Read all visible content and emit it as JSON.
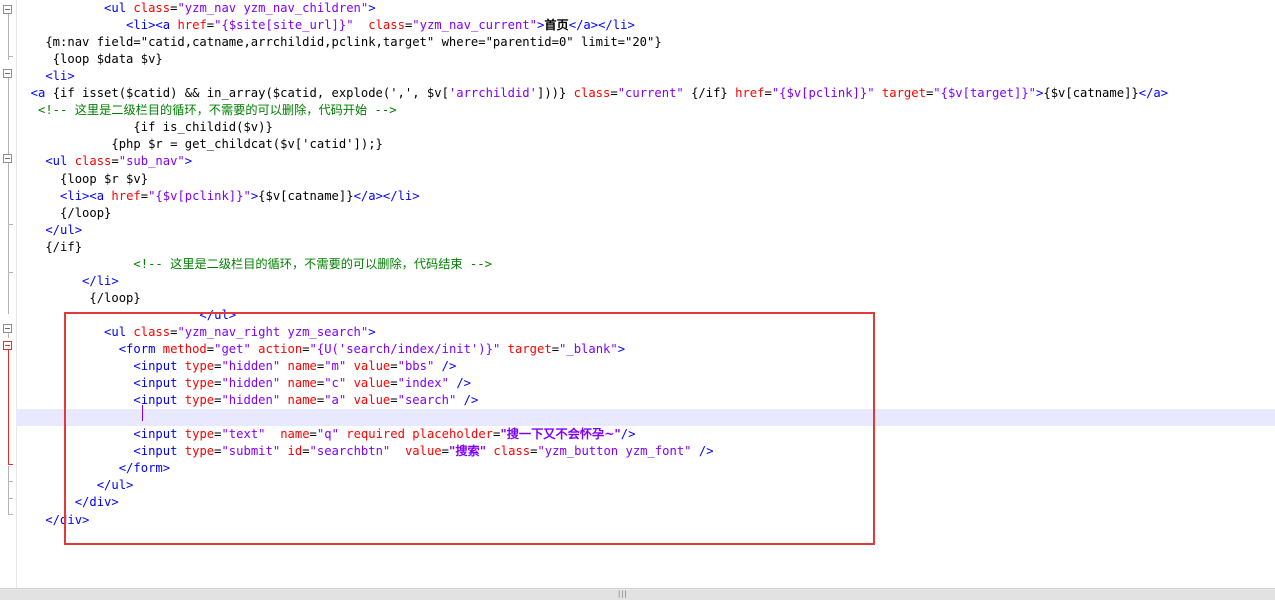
{
  "editor": {
    "lines": [
      [
        [
          "t",
          "            <ul "
        ],
        [
          "a",
          "class"
        ],
        [
          "x",
          "="
        ],
        [
          "v",
          "\"yzm_nav yzm_nav_children\""
        ],
        [
          "t",
          ">"
        ]
      ],
      [
        [
          "t",
          "               <li><a "
        ],
        [
          "a",
          "href"
        ],
        [
          "x",
          "="
        ],
        [
          "v",
          "\"{$site[site_url]}\""
        ],
        [
          "x",
          "  "
        ],
        [
          "a",
          "class"
        ],
        [
          "x",
          "="
        ],
        [
          "v",
          "\"yzm_nav_current\""
        ],
        [
          "t",
          ">"
        ],
        [
          "xb",
          "首页"
        ],
        [
          "t",
          "</a></li>"
        ]
      ],
      [
        [
          "x",
          "    {m:nav field=\"catid,catname,arrchildid,pclink,target\" where=\"parentid=0\" limit=\"20\"}"
        ]
      ],
      [
        [
          "x",
          "     {loop $data $v}"
        ]
      ],
      [
        [
          "t",
          "    <li>"
        ]
      ],
      [
        [
          "t",
          "  <a "
        ],
        [
          "x",
          "{if isset($catid) && in_array($catid, explode(',', $v["
        ],
        [
          "v",
          "'arrchildid'"
        ],
        [
          "x",
          "]))} "
        ],
        [
          "a",
          "class"
        ],
        [
          "x",
          "="
        ],
        [
          "v",
          "\"current\""
        ],
        [
          "x",
          " {/if} "
        ],
        [
          "a",
          "href"
        ],
        [
          "x",
          "="
        ],
        [
          "v",
          "\"{$v[pclink]}\""
        ],
        [
          "x",
          " "
        ],
        [
          "a",
          "target"
        ],
        [
          "x",
          "="
        ],
        [
          "v",
          "\"{$v[target]}\""
        ],
        [
          "t",
          ">"
        ],
        [
          "x",
          "{$v[catname]}"
        ],
        [
          "t",
          "</a>"
        ]
      ],
      [
        [
          "c",
          "   <!-- 这里是二级栏目的循环，不需要的可以删除，代码开始 -->"
        ]
      ],
      [
        [
          "x",
          "                {if is_childid($v)}"
        ]
      ],
      [
        [
          "x",
          "             {php $r = get_childcat($v['catid']);}"
        ]
      ],
      [
        [
          "t",
          "    <ul "
        ],
        [
          "a",
          "class"
        ],
        [
          "x",
          "="
        ],
        [
          "v",
          "\"sub_nav\""
        ],
        [
          "t",
          ">"
        ]
      ],
      [
        [
          "x",
          "      {loop $r $v}"
        ]
      ],
      [
        [
          "t",
          "      <li><a "
        ],
        [
          "a",
          "href"
        ],
        [
          "x",
          "="
        ],
        [
          "v",
          "\"{$v[pclink]}\""
        ],
        [
          "t",
          ">"
        ],
        [
          "x",
          "{$v[catname]}"
        ],
        [
          "t",
          "</a></li>"
        ]
      ],
      [
        [
          "x",
          "      {/loop}"
        ]
      ],
      [
        [
          "t",
          "    </ul>"
        ]
      ],
      [
        [
          "x",
          "    {/if}"
        ]
      ],
      [
        [
          "c",
          "                <!-- 这里是二级栏目的循环，不需要的可以删除，代码结束 -->"
        ]
      ],
      [
        [
          "t",
          "         </li>"
        ]
      ],
      [
        [
          "x",
          "          {/loop}"
        ]
      ],
      [
        [
          "t",
          "                         </ul>"
        ]
      ],
      [
        [
          "t",
          "            <ul "
        ],
        [
          "a",
          "class"
        ],
        [
          "x",
          "="
        ],
        [
          "v",
          "\"yzm_nav_right yzm_search\""
        ],
        [
          "t",
          ">"
        ]
      ],
      [
        [
          "t",
          "              <form "
        ],
        [
          "a",
          "method"
        ],
        [
          "x",
          "="
        ],
        [
          "v",
          "\"get\""
        ],
        [
          "x",
          " "
        ],
        [
          "a",
          "action"
        ],
        [
          "x",
          "="
        ],
        [
          "v",
          "\"{U('search/index/init')}\""
        ],
        [
          "x",
          " "
        ],
        [
          "a",
          "target"
        ],
        [
          "x",
          "="
        ],
        [
          "v",
          "\"_blank\""
        ],
        [
          "t",
          ">"
        ]
      ],
      [
        [
          "t",
          "                <input "
        ],
        [
          "a",
          "type"
        ],
        [
          "x",
          "="
        ],
        [
          "v",
          "\"hidden\""
        ],
        [
          "x",
          " "
        ],
        [
          "a",
          "name"
        ],
        [
          "x",
          "="
        ],
        [
          "v",
          "\"m\""
        ],
        [
          "x",
          " "
        ],
        [
          "a",
          "value"
        ],
        [
          "x",
          "="
        ],
        [
          "v",
          "\"bbs\""
        ],
        [
          "x",
          " "
        ],
        [
          "t",
          "/>"
        ]
      ],
      [
        [
          "t",
          "                <input "
        ],
        [
          "a",
          "type"
        ],
        [
          "x",
          "="
        ],
        [
          "v",
          "\"hidden\""
        ],
        [
          "x",
          " "
        ],
        [
          "a",
          "name"
        ],
        [
          "x",
          "="
        ],
        [
          "v",
          "\"c\""
        ],
        [
          "x",
          " "
        ],
        [
          "a",
          "value"
        ],
        [
          "x",
          "="
        ],
        [
          "v",
          "\"index\""
        ],
        [
          "x",
          " "
        ],
        [
          "t",
          "/>"
        ]
      ],
      [
        [
          "t",
          "                <input "
        ],
        [
          "a",
          "type"
        ],
        [
          "x",
          "="
        ],
        [
          "v",
          "\"hidden\""
        ],
        [
          "x",
          " "
        ],
        [
          "a",
          "name"
        ],
        [
          "x",
          "="
        ],
        [
          "v",
          "\"a\""
        ],
        [
          "x",
          " "
        ],
        [
          "a",
          "value"
        ],
        [
          "x",
          "="
        ],
        [
          "v",
          "\"search\""
        ],
        [
          "x",
          " "
        ],
        [
          "t",
          "/>"
        ]
      ],
      [
        [
          "x",
          ""
        ]
      ],
      [
        [
          "t",
          "                <input "
        ],
        [
          "a",
          "type"
        ],
        [
          "x",
          "="
        ],
        [
          "v",
          "\"text\""
        ],
        [
          "x",
          "  "
        ],
        [
          "a",
          "name"
        ],
        [
          "x",
          "="
        ],
        [
          "v",
          "\"q\""
        ],
        [
          "x",
          " "
        ],
        [
          "a",
          "required"
        ],
        [
          "x",
          " "
        ],
        [
          "a",
          "placeholder"
        ],
        [
          "x",
          "="
        ],
        [
          "b",
          "\"搜一下又不会怀孕~\""
        ],
        [
          "t",
          "/>"
        ]
      ],
      [
        [
          "t",
          "                <input "
        ],
        [
          "a",
          "type"
        ],
        [
          "x",
          "="
        ],
        [
          "v",
          "\"submit\""
        ],
        [
          "x",
          " "
        ],
        [
          "a",
          "id"
        ],
        [
          "x",
          "="
        ],
        [
          "v",
          "\"searchbtn\""
        ],
        [
          "x",
          "  "
        ],
        [
          "a",
          "value"
        ],
        [
          "x",
          "="
        ],
        [
          "b",
          "\"搜索\""
        ],
        [
          "x",
          " "
        ],
        [
          "a",
          "class"
        ],
        [
          "x",
          "="
        ],
        [
          "v",
          "\"yzm_button yzm_font\""
        ],
        [
          "x",
          " "
        ],
        [
          "t",
          "/>"
        ]
      ],
      [
        [
          "t",
          "              </form>"
        ]
      ],
      [
        [
          "t",
          "           </ul>"
        ]
      ],
      [
        [
          "t",
          "        </div>"
        ]
      ],
      [
        [
          "t",
          "    </div>"
        ]
      ]
    ]
  }
}
